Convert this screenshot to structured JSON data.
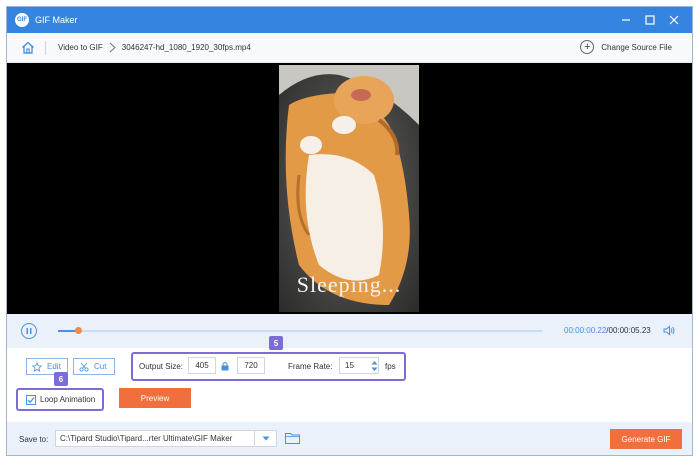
{
  "app": {
    "title": "GIF Maker",
    "logo_text": "GIF"
  },
  "breadcrumb": {
    "section": "Video to GIF",
    "file": "3046247-hd_1080_1920_30fps.mp4"
  },
  "header": {
    "change_source_label": "Change Source File"
  },
  "video": {
    "caption": "Sleeping..."
  },
  "playback": {
    "current_time": "00:00:00.22",
    "total_time": "/00:00:05.23",
    "progress": 0.042
  },
  "tools": {
    "edit_label": "Edit",
    "cut_label": "Cut"
  },
  "output": {
    "size_label": "Output Size:",
    "width": "405",
    "height": "720",
    "frame_rate_label": "Frame Rate:",
    "frame_rate": "15",
    "fps_label": "fps"
  },
  "loop": {
    "label": "Loop Animation",
    "checked": true
  },
  "preview_label": "Preview",
  "annotations": {
    "badge_output": "5",
    "badge_loop": "6"
  },
  "footer": {
    "save_to_label": "Save to:",
    "path": "C:\\Tipard Studio\\Tipard...rter Ultimate\\GIF Maker",
    "generate_label": "Generate GIF"
  },
  "colors": {
    "accent": "#3585e0",
    "orange": "#f06f3c",
    "highlight": "#7b6cd9"
  }
}
